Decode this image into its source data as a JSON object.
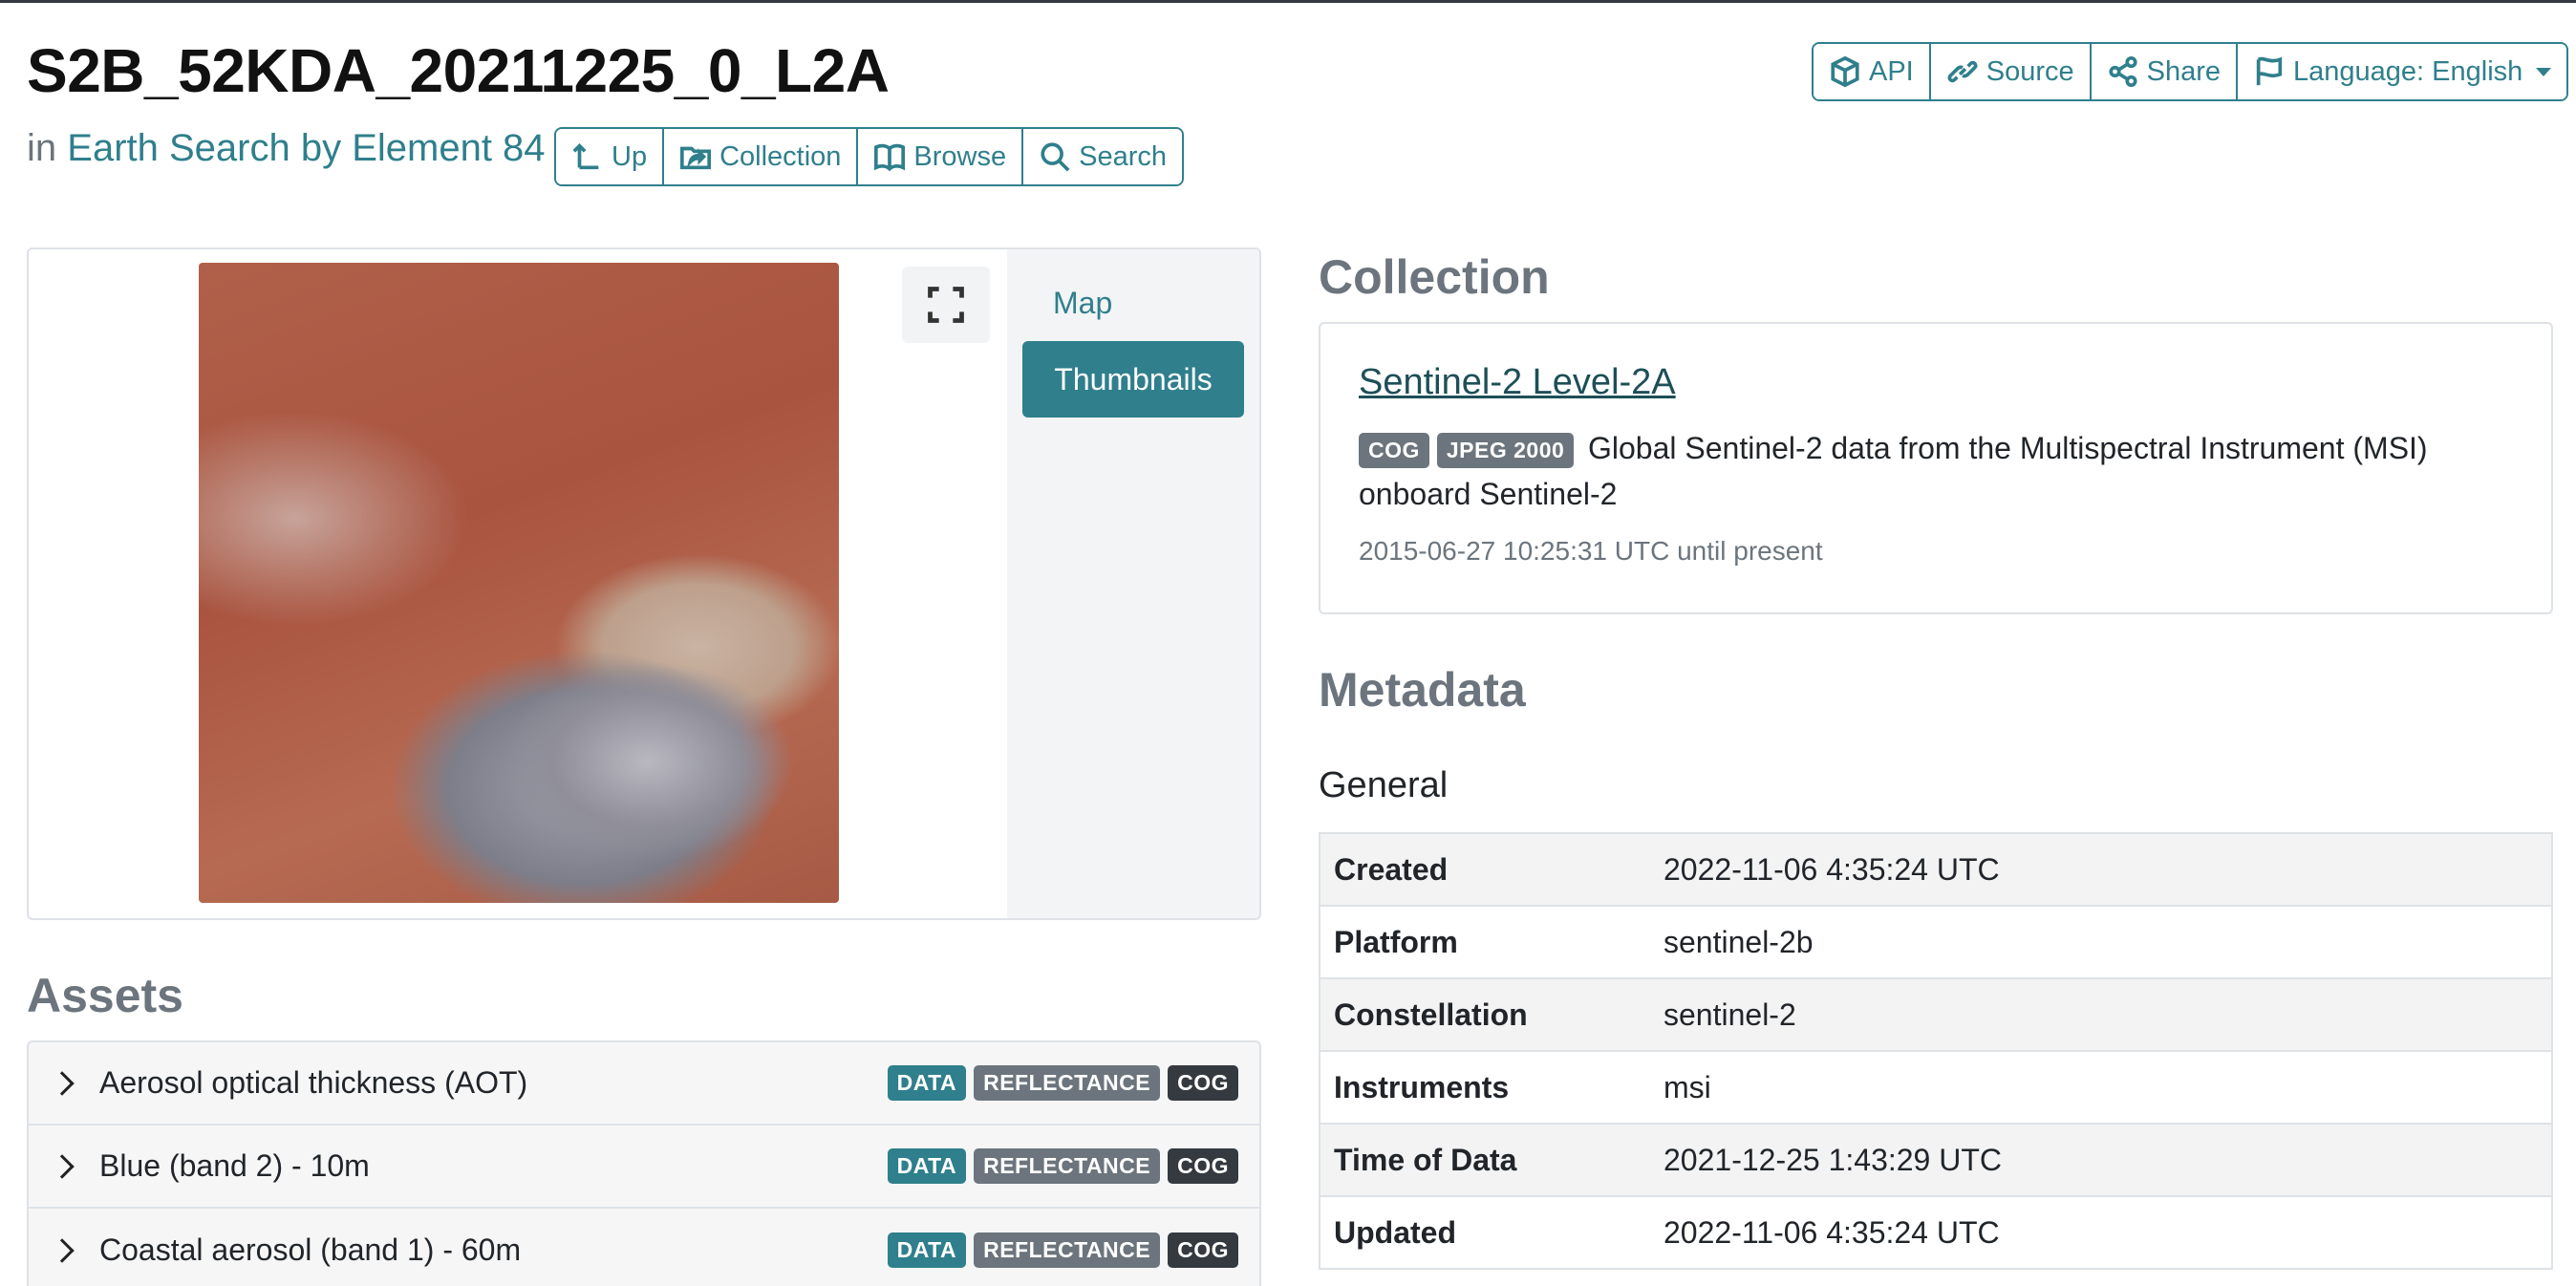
{
  "header": {
    "title": "S2B_52KDA_20211225_0_L2A",
    "in_prefix": "in",
    "catalog_link": "Earth Search by Element 84"
  },
  "nav_buttons": [
    {
      "label": "Up",
      "icon": "level-up-icon"
    },
    {
      "label": "Collection",
      "icon": "folder-share-icon"
    },
    {
      "label": "Browse",
      "icon": "book-icon"
    },
    {
      "label": "Search",
      "icon": "search-icon"
    }
  ],
  "top_buttons": [
    {
      "label": "API",
      "icon": "box-icon"
    },
    {
      "label": "Source",
      "icon": "link-icon"
    },
    {
      "label": "Share",
      "icon": "share-icon"
    },
    {
      "label": "Language: English",
      "icon": "flag-icon"
    }
  ],
  "preview": {
    "tabs": [
      "Map",
      "Thumbnails"
    ],
    "active_tab": "Thumbnails"
  },
  "assets": {
    "title": "Assets",
    "items": [
      {
        "name": "Aerosol optical thickness (AOT)",
        "badges": [
          "DATA",
          "REFLECTANCE",
          "COG"
        ]
      },
      {
        "name": "Blue (band 2) - 10m",
        "badges": [
          "DATA",
          "REFLECTANCE",
          "COG"
        ]
      },
      {
        "name": "Coastal aerosol (band 1) - 60m",
        "badges": [
          "DATA",
          "REFLECTANCE",
          "COG"
        ]
      }
    ]
  },
  "collection": {
    "title": "Collection",
    "name": "Sentinel-2 Level-2A",
    "badges": [
      "COG",
      "JPEG 2000"
    ],
    "description": "Global Sentinel-2 data from the Multispectral Instrument (MSI) onboard Sentinel-2",
    "temporal": "2015-06-27 10:25:31 UTC until present"
  },
  "metadata": {
    "title": "Metadata",
    "section": "General",
    "rows": [
      {
        "key": "Created",
        "value": "2022-11-06 4:35:24 UTC"
      },
      {
        "key": "Platform",
        "value": "sentinel-2b"
      },
      {
        "key": "Constellation",
        "value": "sentinel-2"
      },
      {
        "key": "Instruments",
        "value": "msi"
      },
      {
        "key": "Time of Data",
        "value": "2021-12-25 1:43:29 UTC"
      },
      {
        "key": "Updated",
        "value": "2022-11-06 4:35:24 UTC"
      }
    ]
  },
  "colors": {
    "accent": "#2f7f8c",
    "badge_data": "#2f7f8c",
    "badge_reflectance": "#6c757d",
    "badge_cog": "#343a40"
  }
}
